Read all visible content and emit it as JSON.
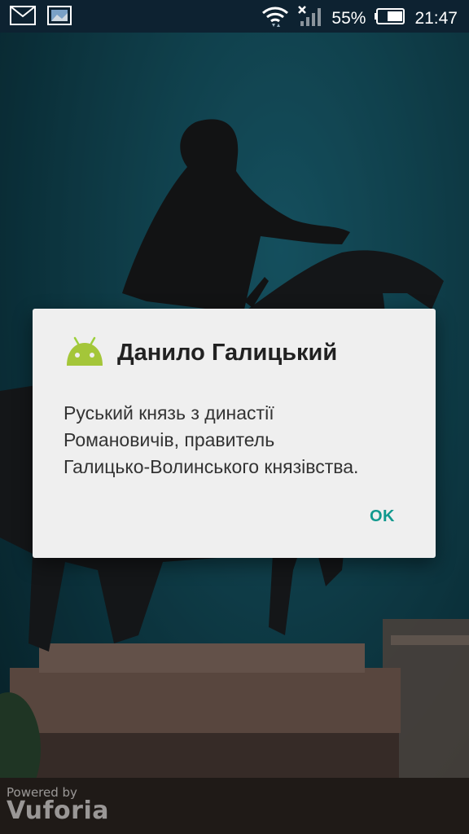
{
  "status_bar": {
    "battery_percent": "55%",
    "time": "21:47",
    "icons": [
      "mail-icon",
      "gallery-icon",
      "wifi-icon",
      "no-signal-icon",
      "battery-icon"
    ]
  },
  "dialog": {
    "title": "Данило Галицький",
    "message": "Руський князь з династії\nРомановичів, правитель\nГалицько-Волинського князівства.",
    "ok_label": "OK",
    "icon": "android-icon",
    "accent_color": "#11998e"
  },
  "watermark": {
    "powered_by": "Powered by",
    "brand": "Vuforia"
  }
}
